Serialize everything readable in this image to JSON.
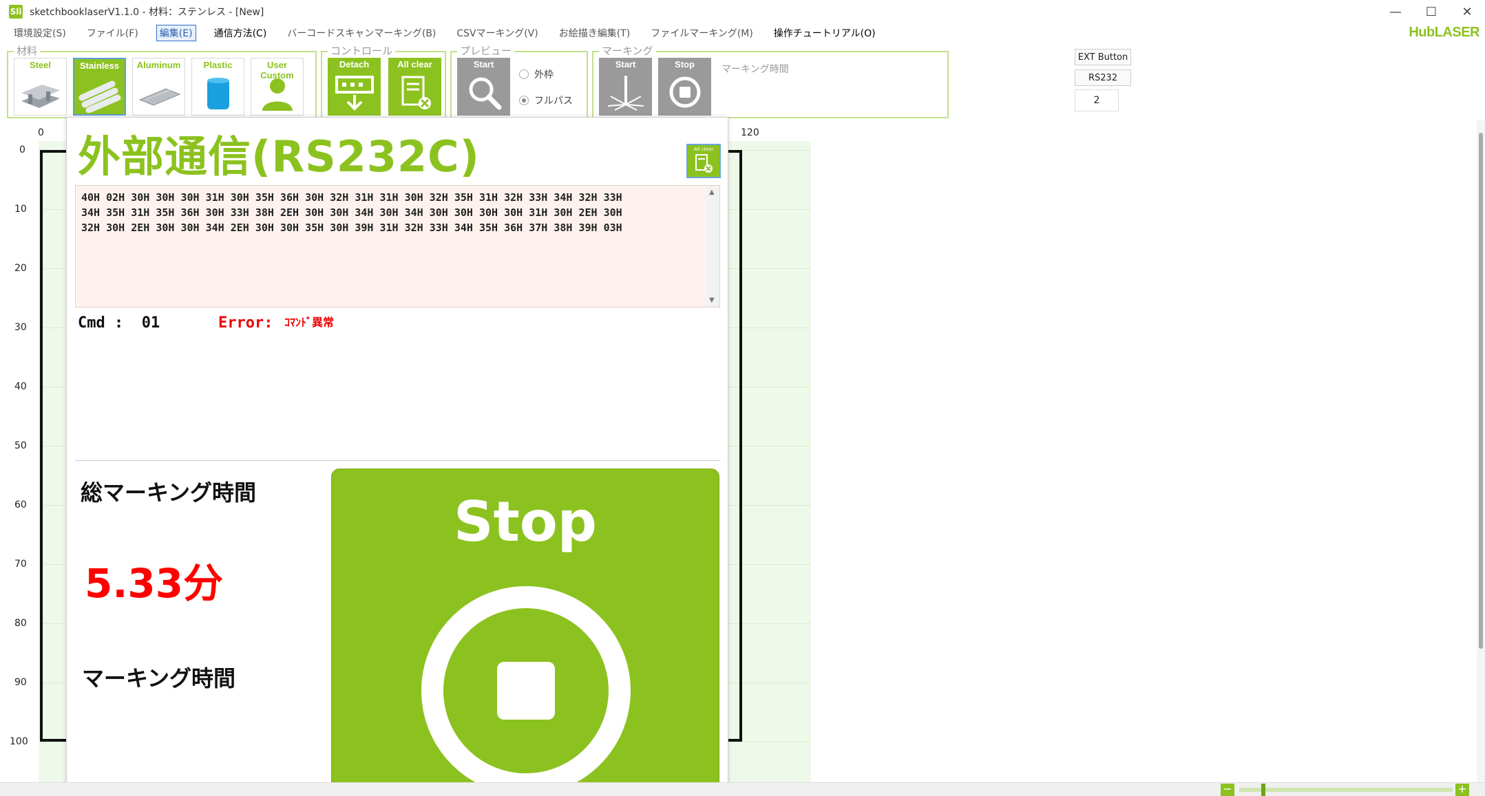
{
  "window": {
    "title": "sketchbooklaserV1.1.0 - 材料：ステンレス - [New]",
    "app_icon": "Sli",
    "minimize": "—",
    "maximize": "☐",
    "close": "✕"
  },
  "menu": {
    "items": [
      "環境設定(S)",
      "ファイル(F)",
      "編集(E)",
      "通信方法(C)",
      "バーコードスキャンマーキング(B)",
      "CSVマーキング(V)",
      "お絵描き編集(T)",
      "ファイルマーキング(M)",
      "操作チュートリアル(O)"
    ],
    "brand": "HubLASER"
  },
  "groups": {
    "material": "材料",
    "control": "コントロール",
    "preview": "プレビュー",
    "marking": "マーキング"
  },
  "materials": [
    "Steel",
    "Stainless",
    "Aluminum",
    "Plastic",
    "User Custom"
  ],
  "control": {
    "detach": "Detach",
    "all_clear": "All clear"
  },
  "preview": {
    "start": "Start",
    "outer_frame": "外枠",
    "full_path": "フルパス"
  },
  "marking": {
    "start": "Start",
    "stop": "Stop",
    "time_label": "マーキング時間"
  },
  "side": {
    "ext_button": "EXT Button",
    "rs232": "RS232",
    "value": "2"
  },
  "ruler": {
    "x_ticks": [
      "0",
      "120"
    ],
    "y_ticks": [
      "0",
      "10",
      "20",
      "30",
      "40",
      "50",
      "60",
      "70",
      "80",
      "90",
      "100"
    ]
  },
  "dialog": {
    "title": "外部通信(RS232C)",
    "all_clear_mini": "All clear",
    "hex_lines": [
      "40H 02H 30H 30H 30H 31H 30H 35H 36H 30H 32H 31H 31H 30H 32H 35H 31H 32H 33H 34H 32H 33H",
      "34H 35H 31H 35H 36H 30H 33H 38H 2EH 30H 30H 34H 30H 34H 30H 30H 30H 30H 31H 30H 2EH 30H",
      "32H 30H 2EH 30H 30H 34H 2EH 30H 30H 35H 30H 39H 31H 32H 33H 34H 35H 36H 37H 38H 39H 03H"
    ],
    "cmd": "Cmd :  01",
    "error_label": "Error:",
    "error_value": "ｺﾏﾝﾄﾞ異常",
    "total_time_label": "総マーキング時間",
    "total_time_value": "5.33分",
    "marking_time_label": "マーキング時間",
    "stop_label": "Stop"
  },
  "zoom": {
    "minus": "−",
    "plus": "+"
  },
  "colors": {
    "accent": "#8cc21f",
    "error": "#ff0000",
    "hex_bg": "#fff2ee"
  }
}
